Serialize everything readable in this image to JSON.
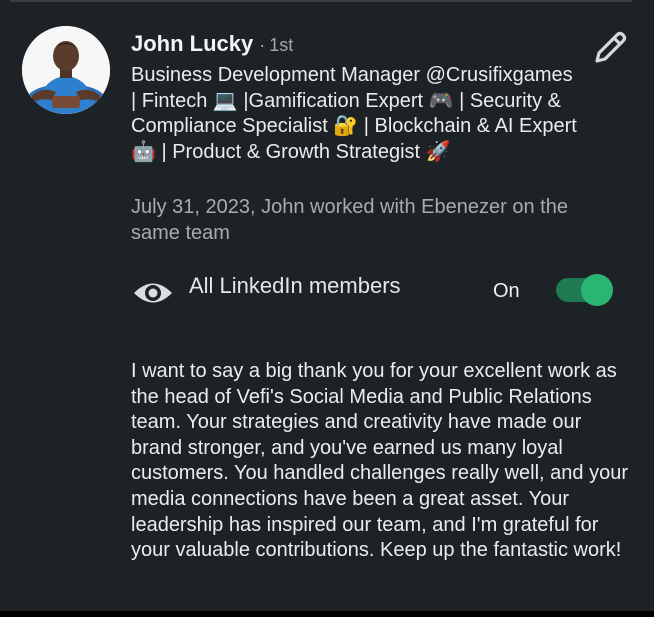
{
  "profile": {
    "name": "John Lucky",
    "separator": "·",
    "connection_degree": "1st",
    "headline": "Business Development Manager @Crusifixgames | Fintech 💻 |Gamification Expert 🎮 | Security & Compliance Specialist 🔐 | Blockchain & AI Expert 🤖 | Product & Growth Strategist 🚀",
    "relationship": "July 31, 2023, John worked with Ebenezer on the same team"
  },
  "visibility": {
    "icon": "eye-icon",
    "label": "All LinkedIn members",
    "state_label": "On",
    "toggle_on": true
  },
  "recommendation_text": "I want to say a big thank you for your excellent work as the head of Vefi's Social Media and Public Relations team. Your strategies and creativity have made our brand stronger, and you've earned us many loyal customers. You handled challenges really well, and your media connections have been a great asset. Your leadership has inspired our team, and I'm grateful for your valuable contributions. Keep up the fantastic work!",
  "icons": {
    "edit": "pencil-icon",
    "avatar": "profile-photo"
  },
  "colors": {
    "background": "#1d2226",
    "toggle_track": "#1f7a52",
    "toggle_knob": "#2bb573",
    "secondary_text": "#a9abad"
  }
}
